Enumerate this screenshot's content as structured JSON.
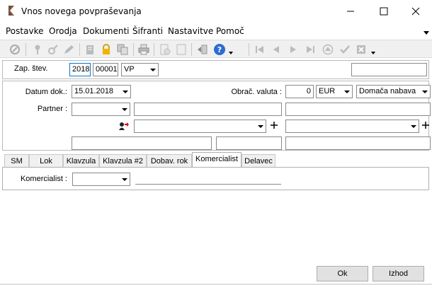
{
  "window": {
    "title": "Vnos novega povpraševanja"
  },
  "menu": {
    "items": [
      {
        "label": "Postavke"
      },
      {
        "label": "Orodja"
      },
      {
        "label": "Dokumenti"
      },
      {
        "label": "Šifranti"
      },
      {
        "label": "Nastavitve"
      },
      {
        "label": "Pomoč"
      }
    ]
  },
  "toolbar": {
    "icons": [
      "circle-icon",
      "pin-icon",
      "link-icon",
      "pencil-icon",
      "trash-icon",
      "lock-icon",
      "copy-icon",
      "print-icon",
      "doc-icon",
      "doc2-icon",
      "exit-icon",
      "help-icon",
      "first-icon",
      "prev-icon",
      "next-icon",
      "last-icon",
      "up-icon",
      "check-icon",
      "cancel-icon"
    ]
  },
  "form": {
    "doc_number_label": "Zap. štev.",
    "year": "2018",
    "number": "00001",
    "doc_type": "VP",
    "date_label": "Datum dok.:",
    "date": "15.01.2018",
    "currency_label": "Obrač. valuta :",
    "rate": "0",
    "currency": "EUR",
    "procurement": "Domača nabava",
    "partner_label": "Partner :",
    "partner_value": "",
    "tabs": [
      "SM",
      "Lok",
      "Klavzula",
      "Klavzula #2",
      "Dobav. rok",
      "Komercialist",
      "Delavec"
    ],
    "active_tab": "Komercialist",
    "sales_label": "Komercialist :",
    "sales_value": ""
  },
  "buttons": {
    "ok": "Ok",
    "exit": "Izhod"
  },
  "colors": {
    "toolbar_bg": "#f0f0f0",
    "accent": "#000080"
  }
}
